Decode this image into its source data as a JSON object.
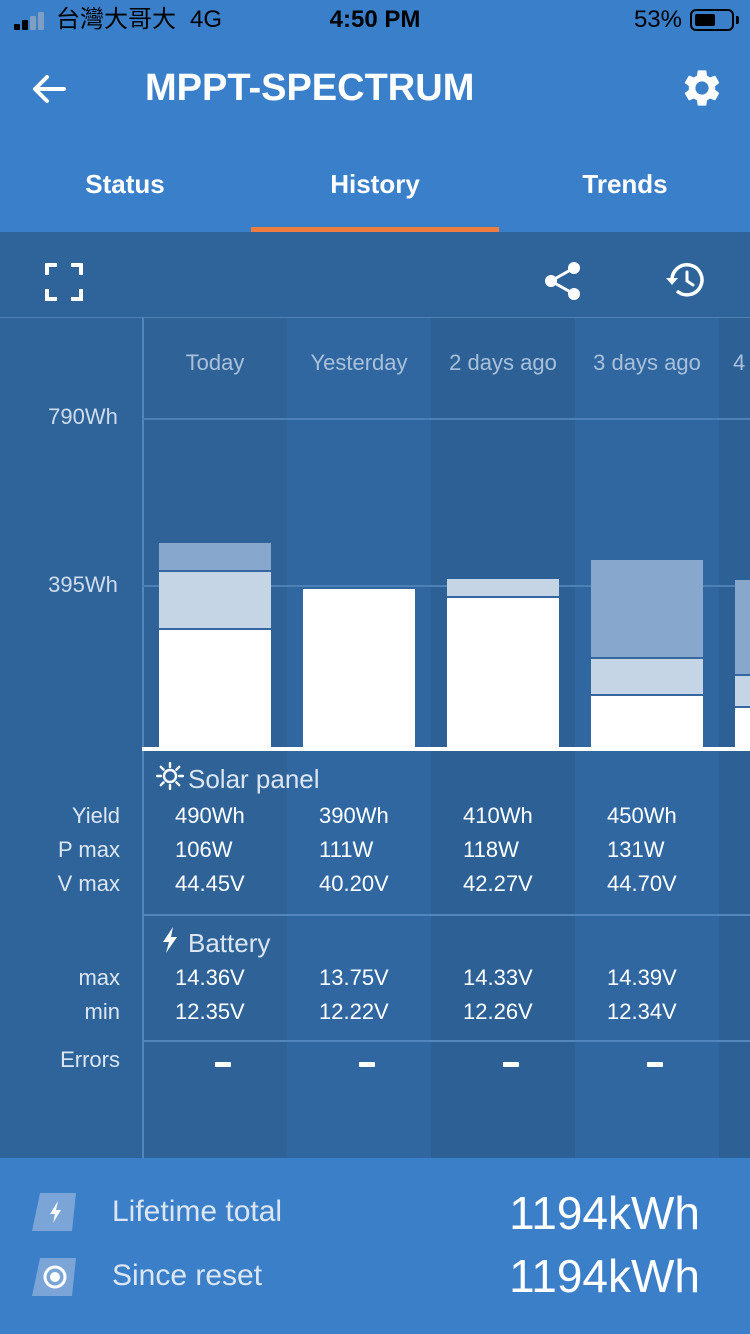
{
  "status_bar": {
    "carrier": "台灣大哥大",
    "network": "4G",
    "time": "4:50 PM",
    "battery": "53%"
  },
  "header": {
    "title": "MPPT-SPECTRUM"
  },
  "tabs": [
    {
      "label": "Status"
    },
    {
      "label": "History"
    },
    {
      "label": "Trends"
    }
  ],
  "toolbar": {
    "icons": [
      "fullscreen-icon",
      "share-icon",
      "history-icon"
    ]
  },
  "chart": {
    "y_labels": [
      "790Wh",
      "395Wh"
    ],
    "days": [
      "Today",
      "Yesterday",
      "2 days ago",
      "3 days ago",
      "4"
    ]
  },
  "solar": {
    "title": "Solar panel",
    "row_labels": [
      "Yield",
      "P max",
      "V max"
    ],
    "columns": [
      {
        "yield": "490Wh",
        "pmax": "106W",
        "vmax": "44.45V"
      },
      {
        "yield": "390Wh",
        "pmax": "111W",
        "vmax": "40.20V"
      },
      {
        "yield": "410Wh",
        "pmax": "118W",
        "vmax": "42.27V"
      },
      {
        "yield": "450Wh",
        "pmax": "131W",
        "vmax": "44.70V"
      }
    ]
  },
  "battery": {
    "title": "Battery",
    "row_labels": [
      "max",
      "min"
    ],
    "columns": [
      {
        "max": "14.36V",
        "min": "12.35V"
      },
      {
        "max": "13.75V",
        "min": "12.22V"
      },
      {
        "max": "14.33V",
        "min": "12.26V"
      },
      {
        "max": "14.39V",
        "min": "12.34V"
      }
    ]
  },
  "errors": {
    "label": "Errors"
  },
  "footer": {
    "lifetime_label": "Lifetime total",
    "lifetime_value": "1194kWh",
    "reset_label": "Since reset",
    "reset_value": "1194kWh"
  },
  "colors": {
    "header": "#3a7fc9",
    "accent": "#ee7d3f",
    "background": "#2e6499"
  }
}
